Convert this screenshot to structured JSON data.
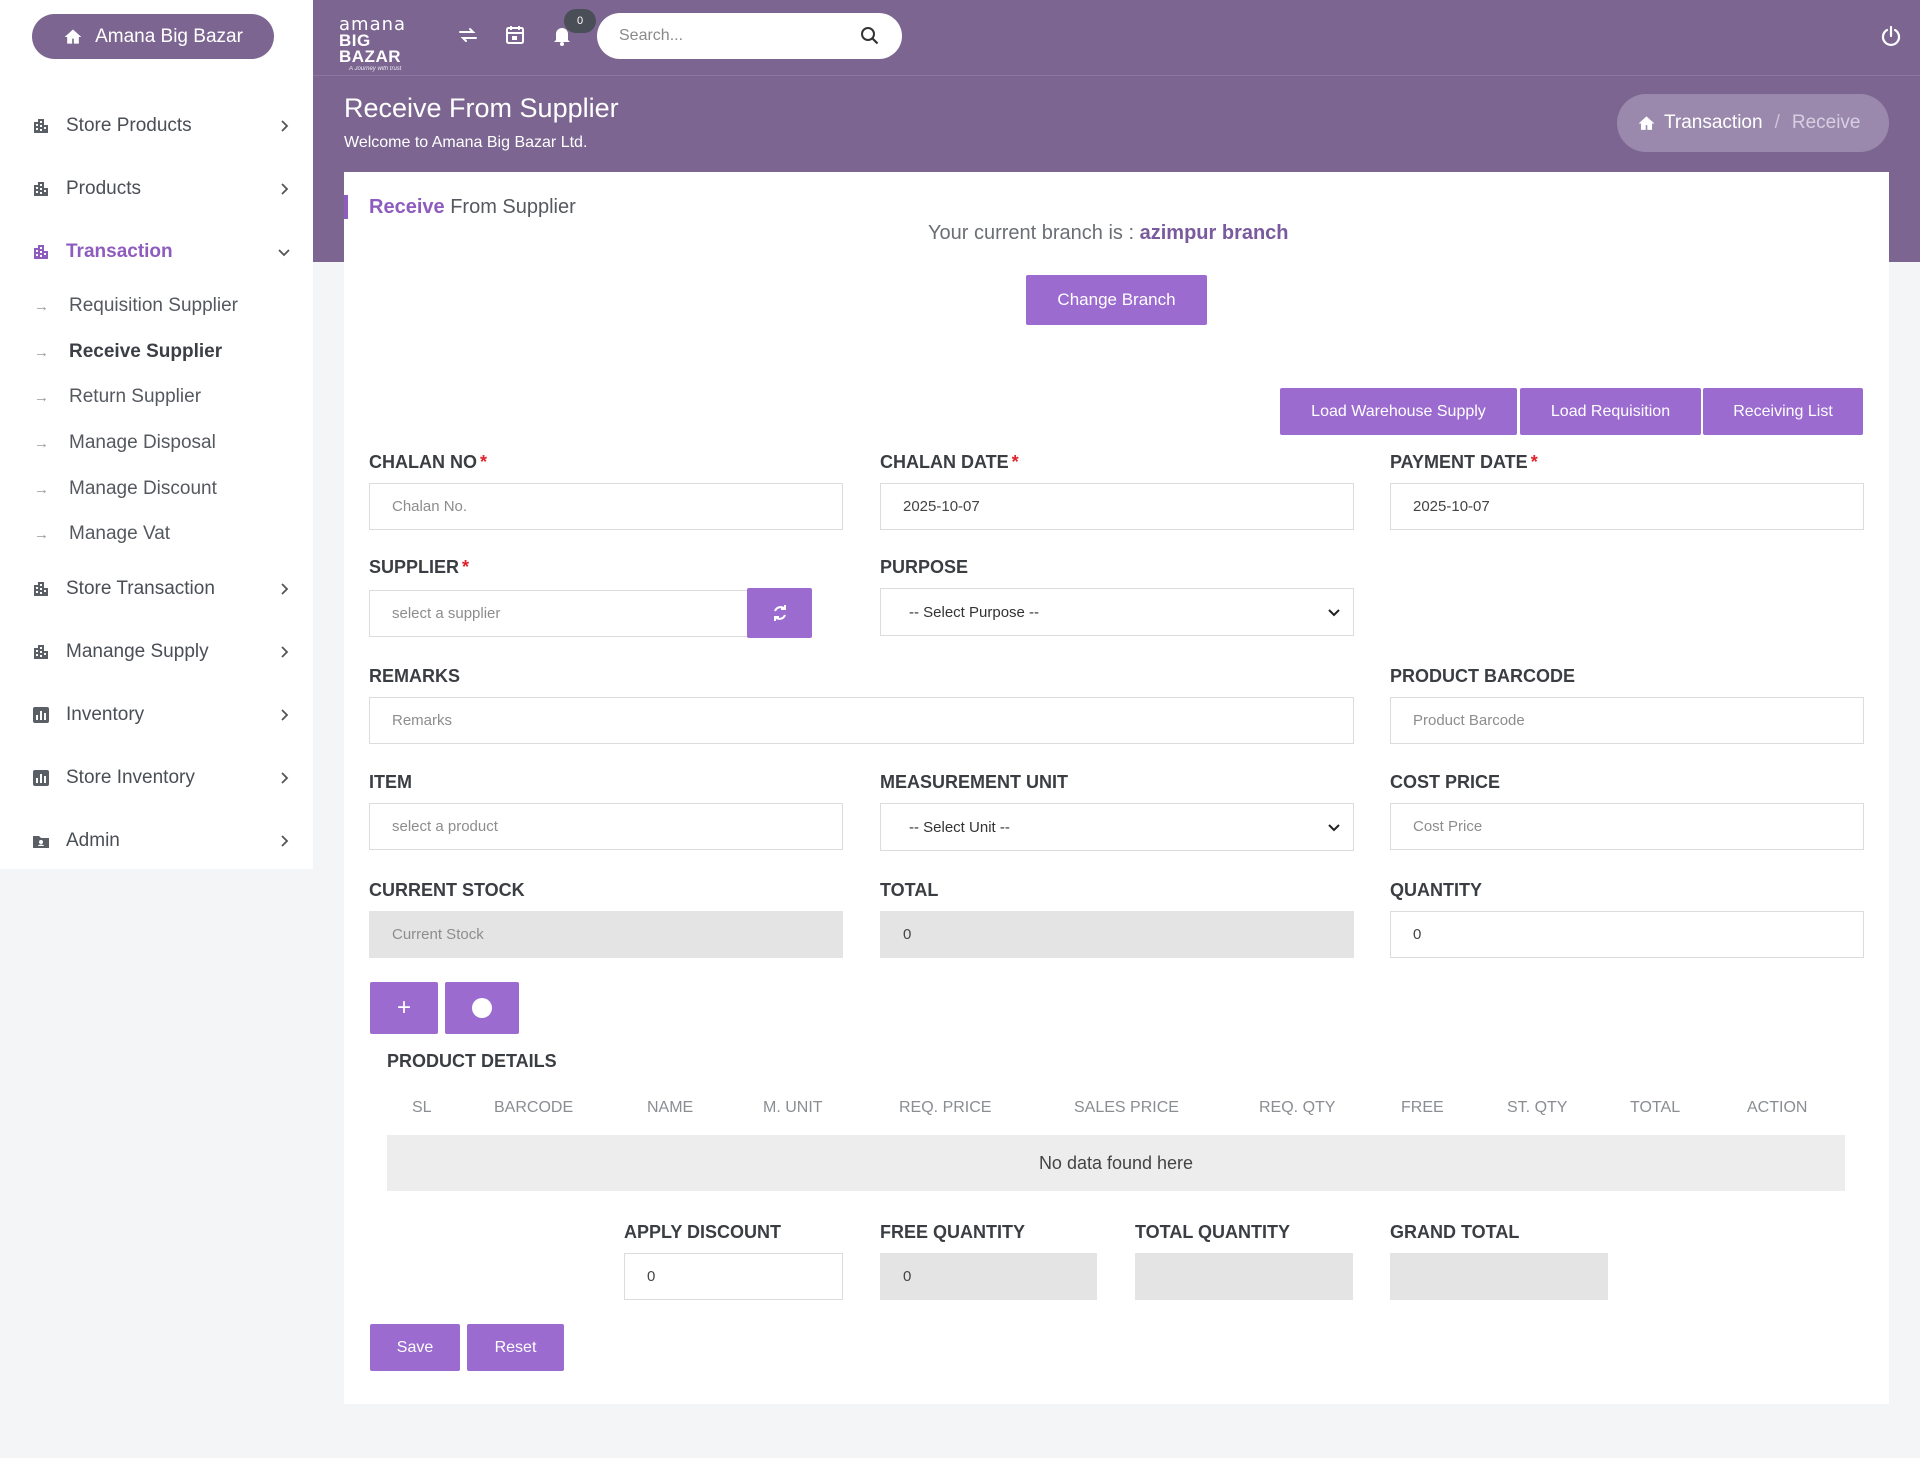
{
  "sidebar": {
    "brand": "Amana Big Bazar",
    "items": [
      {
        "label": "Store Products"
      },
      {
        "label": "Products"
      },
      {
        "label": "Transaction"
      },
      {
        "label": "Store Transaction"
      },
      {
        "label": "Manange Supply"
      },
      {
        "label": "Inventory"
      },
      {
        "label": "Store Inventory"
      },
      {
        "label": "Admin"
      }
    ],
    "sub_items": [
      {
        "label": "Requisition Supplier"
      },
      {
        "label": "Receive Supplier"
      },
      {
        "label": "Return Supplier"
      },
      {
        "label": "Manage Disposal"
      },
      {
        "label": "Manage Discount"
      },
      {
        "label": "Manage Vat"
      }
    ]
  },
  "topbar": {
    "logo_line1": "amana",
    "logo_line2": "BIG BAZAR",
    "logo_tagline": "A Journey with trust",
    "notification_count": "0",
    "search_placeholder": "Search..."
  },
  "header": {
    "title": "Receive From Supplier",
    "subtitle": "Welcome to Amana Big Bazar Ltd.",
    "breadcrumb": {
      "root": "Transaction",
      "separator": "/",
      "current": "Receive"
    }
  },
  "card": {
    "title_highlight": "Receive",
    "title_rest": "From Supplier",
    "branch_prefix": "Your current branch is :",
    "branch_name": "azimpur branch",
    "change_branch": "Change Branch",
    "actions": {
      "load_warehouse": "Load Warehouse Supply",
      "load_requisition": "Load Requisition",
      "receiving_list": "Receiving List"
    }
  },
  "form": {
    "chalan_no": {
      "label": "CHALAN NO",
      "placeholder": "Chalan No."
    },
    "chalan_date": {
      "label": "CHALAN DATE",
      "value": "2025-10-07"
    },
    "payment_date": {
      "label": "PAYMENT DATE",
      "value": "2025-10-07"
    },
    "supplier": {
      "label": "SUPPLIER",
      "placeholder": "select a supplier"
    },
    "purpose": {
      "label": "PURPOSE",
      "value": "-- Select Purpose --"
    },
    "remarks": {
      "label": "REMARKS",
      "placeholder": "Remarks"
    },
    "product_barcode": {
      "label": "PRODUCT BARCODE",
      "placeholder": "Product Barcode"
    },
    "item": {
      "label": "ITEM",
      "placeholder": "select a product"
    },
    "measurement_unit": {
      "label": "MEASUREMENT UNIT",
      "value": "-- Select Unit --"
    },
    "cost_price": {
      "label": "COST PRICE",
      "placeholder": "Cost Price"
    },
    "current_stock": {
      "label": "CURRENT STOCK",
      "placeholder": "Current Stock"
    },
    "total": {
      "label": "TOTAL",
      "value": "0"
    },
    "quantity": {
      "label": "QUANTITY",
      "value": "0"
    },
    "add_symbol": "+"
  },
  "table": {
    "title": "PRODUCT DETAILS",
    "columns": [
      "SL",
      "BARCODE",
      "NAME",
      "M. UNIT",
      "REQ. PRICE",
      "SALES PRICE",
      "REQ. QTY",
      "FREE",
      "ST. QTY",
      "TOTAL",
      "ACTION"
    ],
    "empty_text": "No data found here"
  },
  "summary": {
    "apply_discount": {
      "label": "APPLY DISCOUNT",
      "value": "0"
    },
    "free_quantity": {
      "label": "FREE QUANTITY",
      "value": "0"
    },
    "total_quantity": {
      "label": "TOTAL QUANTITY",
      "value": ""
    },
    "grand_total": {
      "label": "GRAND TOTAL",
      "value": ""
    }
  },
  "footer_buttons": {
    "save": "Save",
    "reset": "Reset"
  },
  "colors": {
    "brand_purple": "#7c6691",
    "accent": "#9b6bd0",
    "required": "#e0202a"
  }
}
